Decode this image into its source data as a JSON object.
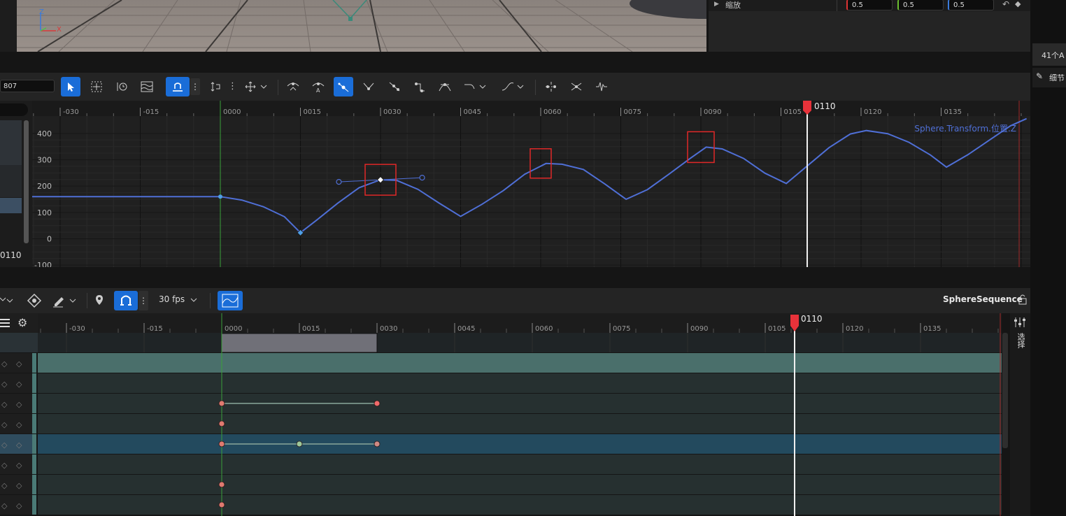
{
  "viewport": {
    "axis_z": "Z",
    "axis_x": "X"
  },
  "details_panel": {
    "scale_label": "缩放",
    "scale_x": "0.5",
    "scale_y": "0.5",
    "scale_z": "0.5"
  },
  "right_strip": {
    "actor_count": "41个A",
    "details_tab": "细节"
  },
  "curve_editor": {
    "frame_field": "807",
    "ruler_ticks": [
      "-030",
      "-015",
      "0000",
      "0015",
      "0030",
      "0045",
      "0060",
      "0075",
      "0090",
      "0105",
      "0120",
      "0135"
    ],
    "playhead_label": "0110",
    "left_frame_value": "0110",
    "y_axis_labels": [
      "400",
      "300",
      "200",
      "100",
      "0",
      "-100"
    ],
    "curve_name": "Sphere.Transform.位置.Z"
  },
  "sequencer": {
    "fps_label": "30 fps",
    "sequence_name": "SphereSequence",
    "ruler_ticks": [
      "-030",
      "-015",
      "0000",
      "0015",
      "0030",
      "0045",
      "0060",
      "0075",
      "0090",
      "0105",
      "0120",
      "0135"
    ],
    "playhead_label": "0110",
    "select_tab": "选择"
  },
  "colors": {
    "accent_blue": "#1a6dd8",
    "curve_blue": "#4f6fd6",
    "playhead_red": "#e8323a",
    "selection_red": "#e02828",
    "track_teal": "#4a6f6b",
    "track_selected": "#234a5e",
    "key_red": "#e07a70",
    "key_green": "#9ec89a"
  }
}
